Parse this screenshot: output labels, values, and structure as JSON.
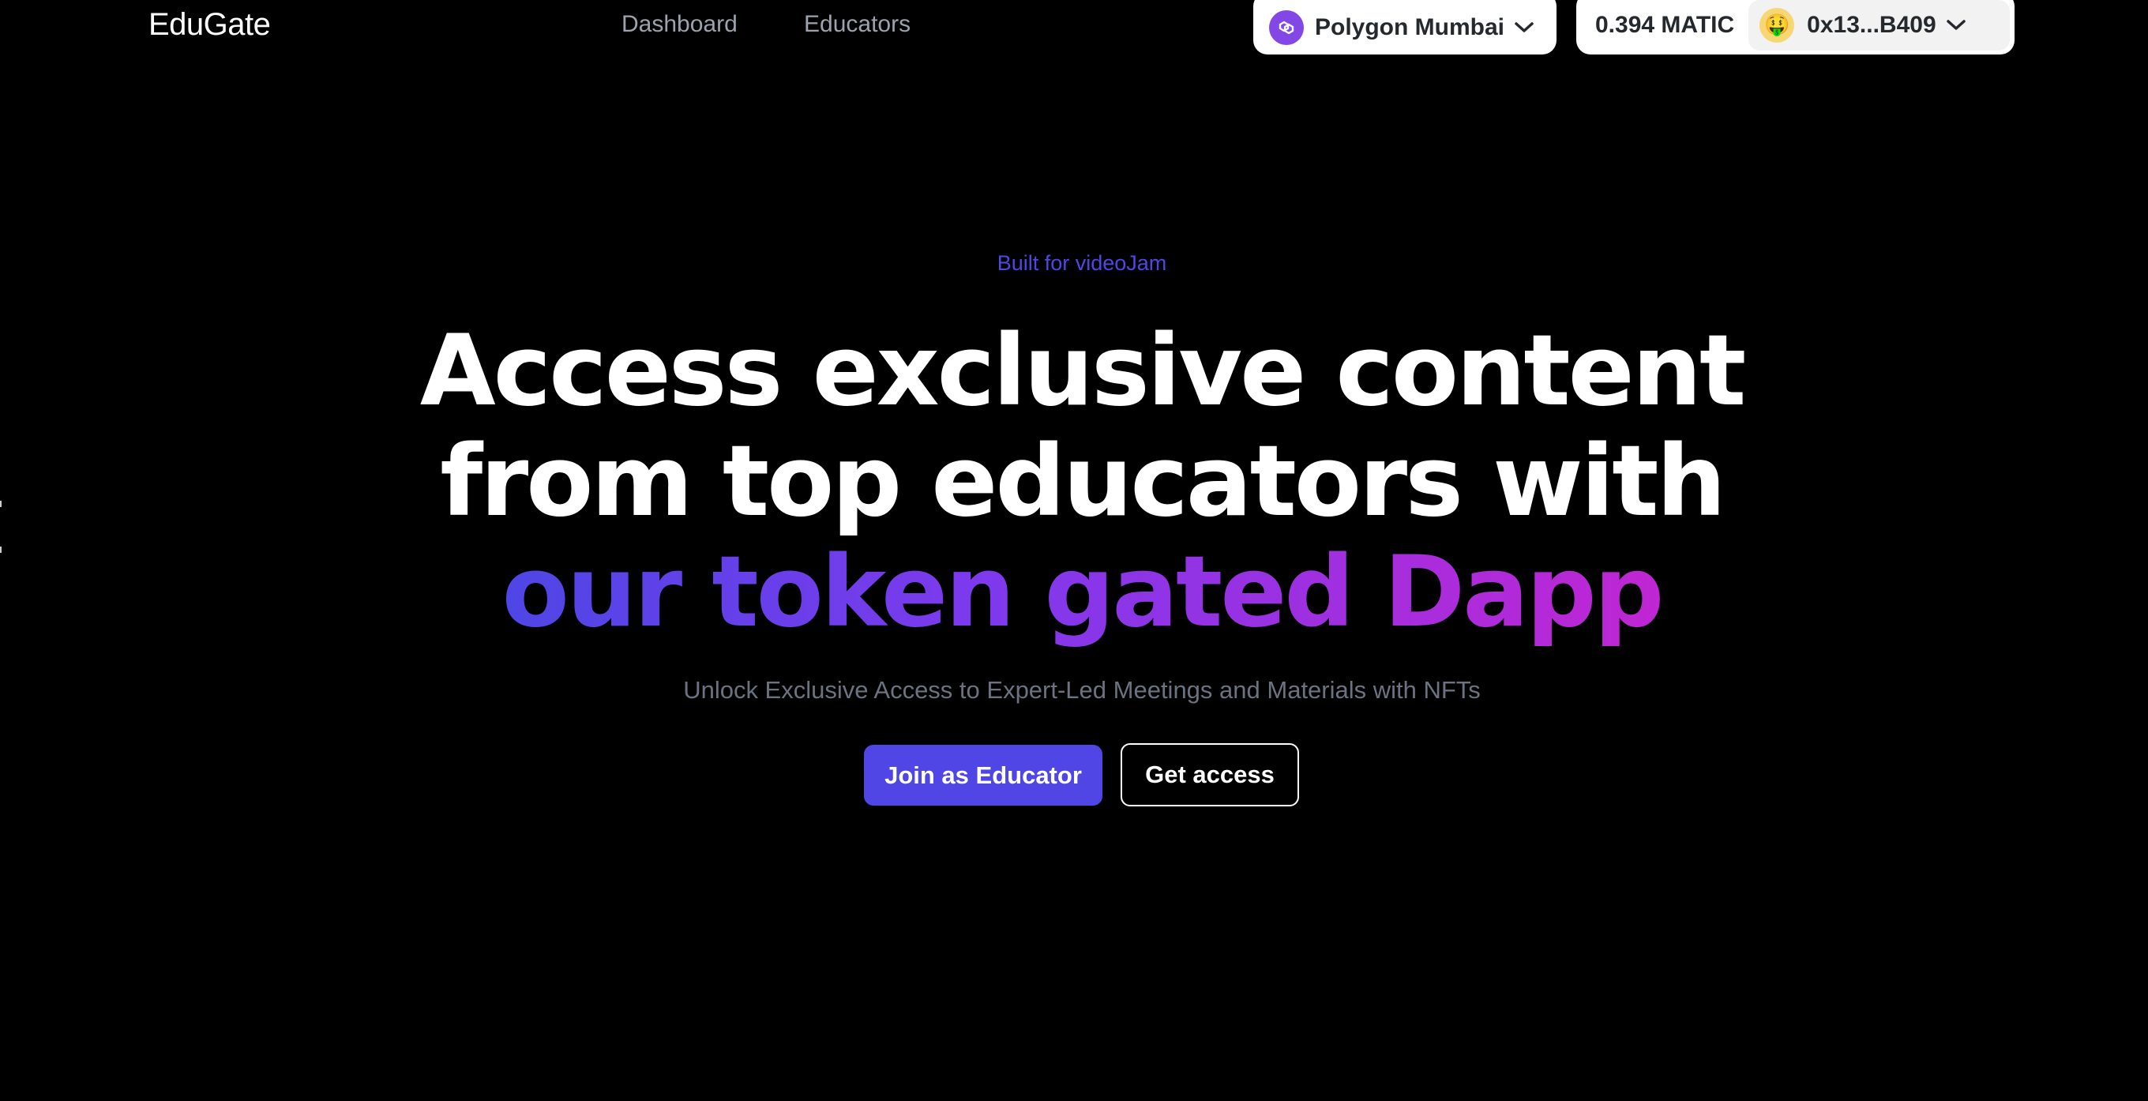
{
  "nav": {
    "brand": "EduGate",
    "links": [
      "Dashboard",
      "Educators"
    ]
  },
  "wallet": {
    "chain_label": "Polygon Mumbai",
    "chain_icon": "polygon-icon",
    "balance": "0.394 MATIC",
    "avatar_emoji": "🤑",
    "address": "0x13...B409"
  },
  "hero": {
    "eyebrow": "Built for videoJam",
    "headline_line1": "Access exclusive content",
    "headline_line2": "from top educators with",
    "headline_line3": "our token gated Dapp",
    "subtitle": "Unlock Exclusive Access to Expert-Led Meetings and Materials with NFTs",
    "primary_cta": "Join as Educator",
    "secondary_cta": "Get access"
  },
  "colors": {
    "background": "#000000",
    "accent": "#4f46e5",
    "gradient_start": "#4f46e5",
    "gradient_end": "#c026d3",
    "polygon_purple": "#8247e5",
    "muted_text": "#6b7280"
  }
}
